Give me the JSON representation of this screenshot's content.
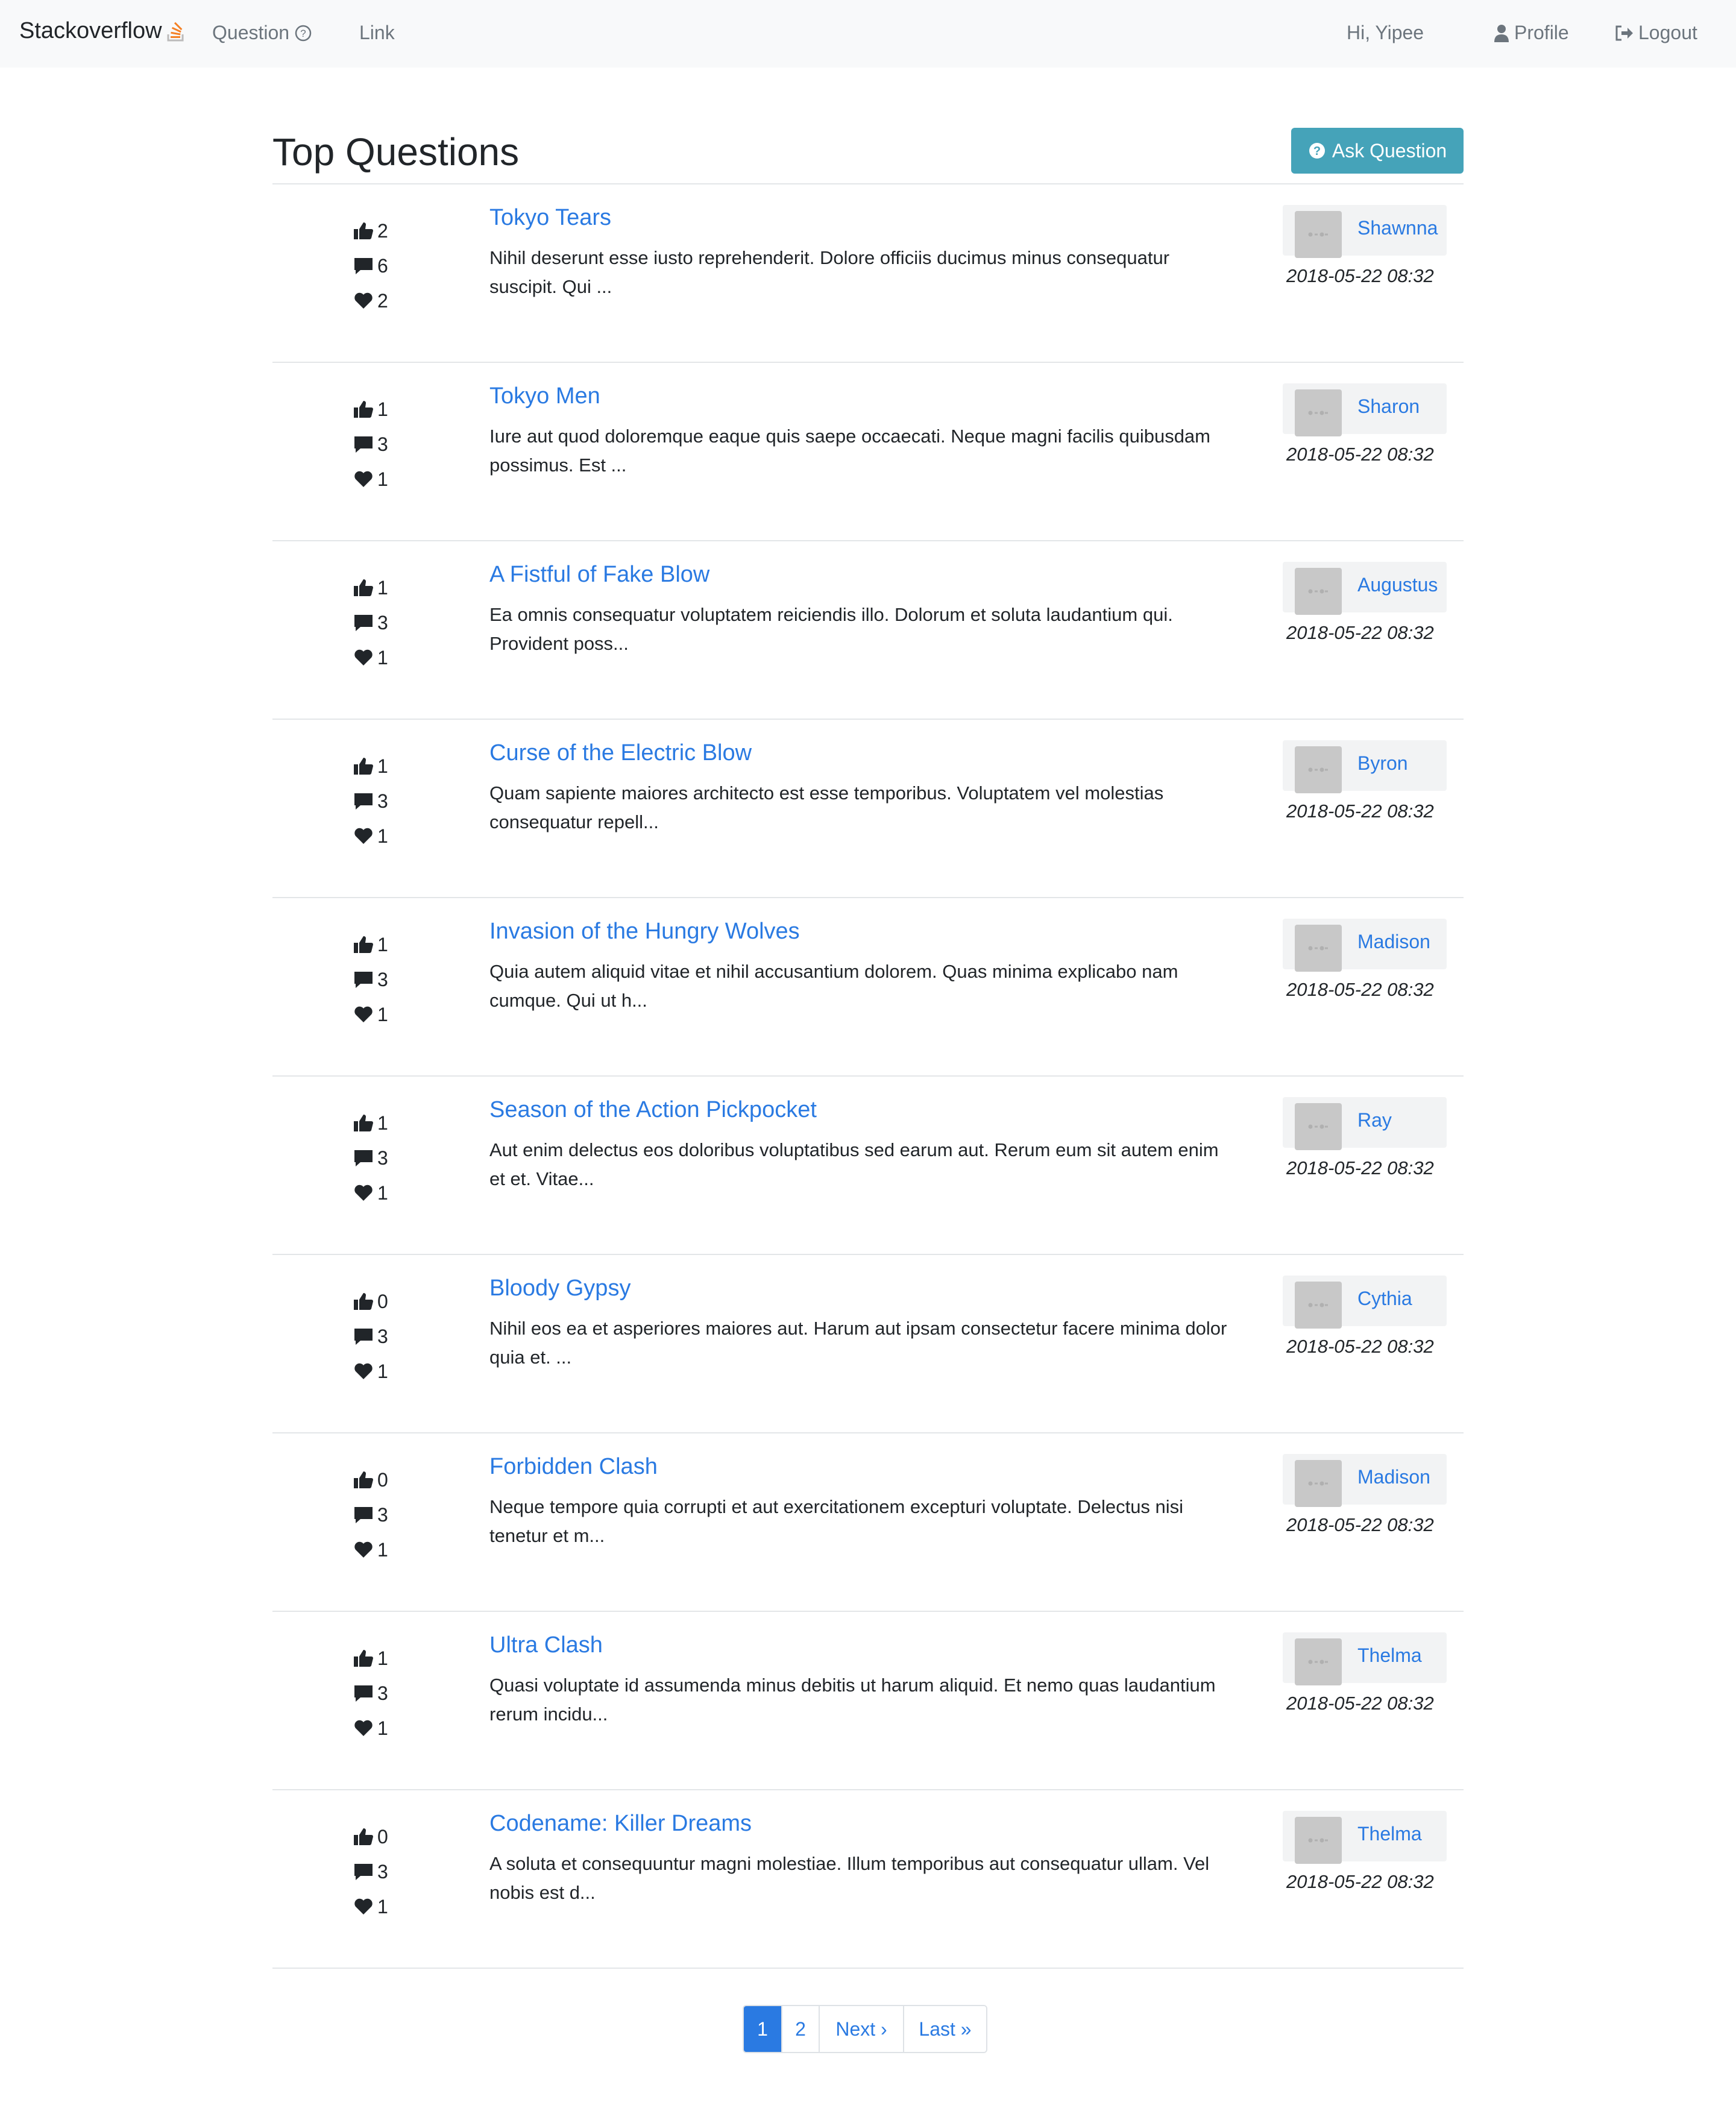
{
  "nav": {
    "brand": "Stackoverflow",
    "question": "Question",
    "link": "Link",
    "greeting": "Hi, Yipee",
    "profile": "Profile",
    "logout": "Logout"
  },
  "header": {
    "title": "Top Questions",
    "ask_button": "Ask Question"
  },
  "questions": [
    {
      "title": "Tokyo Tears",
      "excerpt": "Nihil deserunt esse iusto reprehenderit. Dolore officiis ducimus minus consequatur suscipit. Qui ...",
      "likes": "2",
      "comments": "6",
      "favorites": "2",
      "author": "Shawnna",
      "date": "2018-05-22 08:32"
    },
    {
      "title": "Tokyo Men",
      "excerpt": "Iure aut quod doloremque eaque quis saepe occaecati. Neque magni facilis quibusdam possimus. Est ...",
      "likes": "1",
      "comments": "3",
      "favorites": "1",
      "author": "Sharon",
      "date": "2018-05-22 08:32"
    },
    {
      "title": "A Fistful of Fake Blow",
      "excerpt": "Ea omnis consequatur voluptatem reiciendis illo. Dolorum et soluta laudantium qui. Provident poss...",
      "likes": "1",
      "comments": "3",
      "favorites": "1",
      "author": "Augustus",
      "date": "2018-05-22 08:32"
    },
    {
      "title": "Curse of the Electric Blow",
      "excerpt": "Quam sapiente maiores architecto est esse temporibus. Voluptatem vel molestias consequatur repell...",
      "likes": "1",
      "comments": "3",
      "favorites": "1",
      "author": "Byron",
      "date": "2018-05-22 08:32"
    },
    {
      "title": "Invasion of the Hungry Wolves",
      "excerpt": "Quia autem aliquid vitae et nihil accusantium dolorem. Quas minima explicabo nam cumque. Qui ut h...",
      "likes": "1",
      "comments": "3",
      "favorites": "1",
      "author": "Madison",
      "date": "2018-05-22 08:32"
    },
    {
      "title": "Season of the Action Pickpocket",
      "excerpt": "Aut enim delectus eos doloribus voluptatibus sed earum aut. Rerum eum sit autem enim et et. Vitae...",
      "likes": "1",
      "comments": "3",
      "favorites": "1",
      "author": "Ray",
      "date": "2018-05-22 08:32"
    },
    {
      "title": "Bloody Gypsy",
      "excerpt": "Nihil eos ea et asperiores maiores aut. Harum aut ipsam consectetur facere minima dolor quia et. ...",
      "likes": "0",
      "comments": "3",
      "favorites": "1",
      "author": "Cythia",
      "date": "2018-05-22 08:32"
    },
    {
      "title": "Forbidden Clash",
      "excerpt": "Neque tempore quia corrupti et aut exercitationem excepturi voluptate. Delectus nisi tenetur et m...",
      "likes": "0",
      "comments": "3",
      "favorites": "1",
      "author": "Madison",
      "date": "2018-05-22 08:32"
    },
    {
      "title": "Ultra Clash",
      "excerpt": "Quasi voluptate id assumenda minus debitis ut harum aliquid. Et nemo quas laudantium rerum incidu...",
      "likes": "1",
      "comments": "3",
      "favorites": "1",
      "author": "Thelma",
      "date": "2018-05-22 08:32"
    },
    {
      "title": "Codename: Killer Dreams",
      "excerpt": "A soluta et consequuntur magni molestiae. Illum temporibus aut consequatur ullam. Vel nobis est d...",
      "likes": "0",
      "comments": "3",
      "favorites": "1",
      "author": "Thelma",
      "date": "2018-05-22 08:32"
    }
  ],
  "pagination": {
    "pages": [
      "1",
      "2"
    ],
    "active": "1",
    "next": "Next ›",
    "last": "Last »"
  },
  "colors": {
    "link": "#2a7ae2",
    "ask_button": "#45a3b9",
    "brand_icon": "#f48024"
  },
  "icons": {
    "brand": "stackoverflow-icon",
    "question": "question-circle-icon",
    "profile": "user-icon",
    "logout": "sign-out-icon",
    "ask": "question-circle-icon",
    "likes": "thumbs-up-icon",
    "comments": "comment-icon",
    "favorites": "heart-icon"
  }
}
